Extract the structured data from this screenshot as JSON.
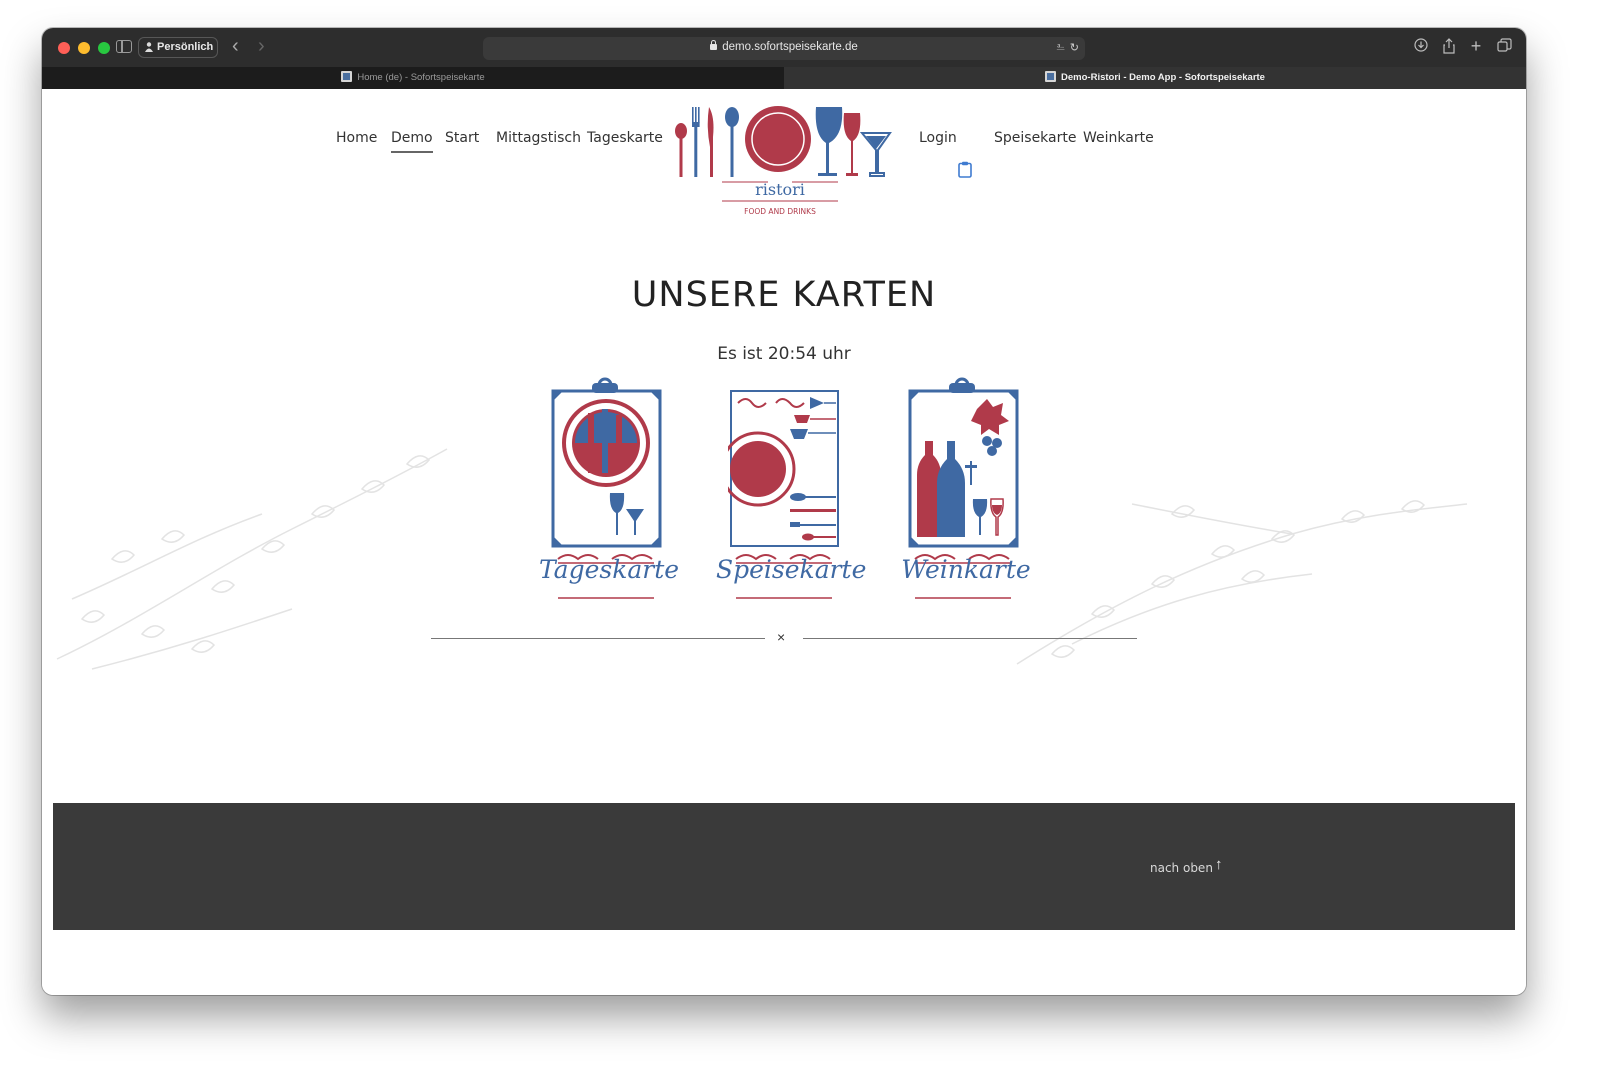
{
  "browser": {
    "profile_label": "Persönlich",
    "url": "demo.sofortspeisekarte.de",
    "tabs": [
      {
        "label": "Home (de) - Sofortspeisekarte",
        "active": false
      },
      {
        "label": "Demo-Ristori - Demo App - Sofortspeisekarte",
        "active": true
      }
    ]
  },
  "site": {
    "nav_left": [
      "Home",
      "Demo",
      "Start",
      "Mittagstisch",
      "Tageskarte"
    ],
    "nav_right": [
      "Login",
      "Speisekarte",
      "Weinkarte"
    ],
    "active_nav": "Demo",
    "logo": {
      "name": "ristori",
      "tagline": "FOOD AND DRINKS"
    }
  },
  "main": {
    "title": "UNSERE KARTEN",
    "time_text": "Es ist 20:54 uhr",
    "cards": [
      {
        "label": "Tageskarte"
      },
      {
        "label": "Speisekarte"
      },
      {
        "label": "Weinkarte"
      }
    ],
    "divider_icon": "×"
  },
  "footer": {
    "back_to_top": "nach oben",
    "arrow": "↑"
  },
  "colors": {
    "brand_red": "#b03a4a",
    "brand_blue": "#3f69a3",
    "footer_bg": "#3a3a3a"
  }
}
